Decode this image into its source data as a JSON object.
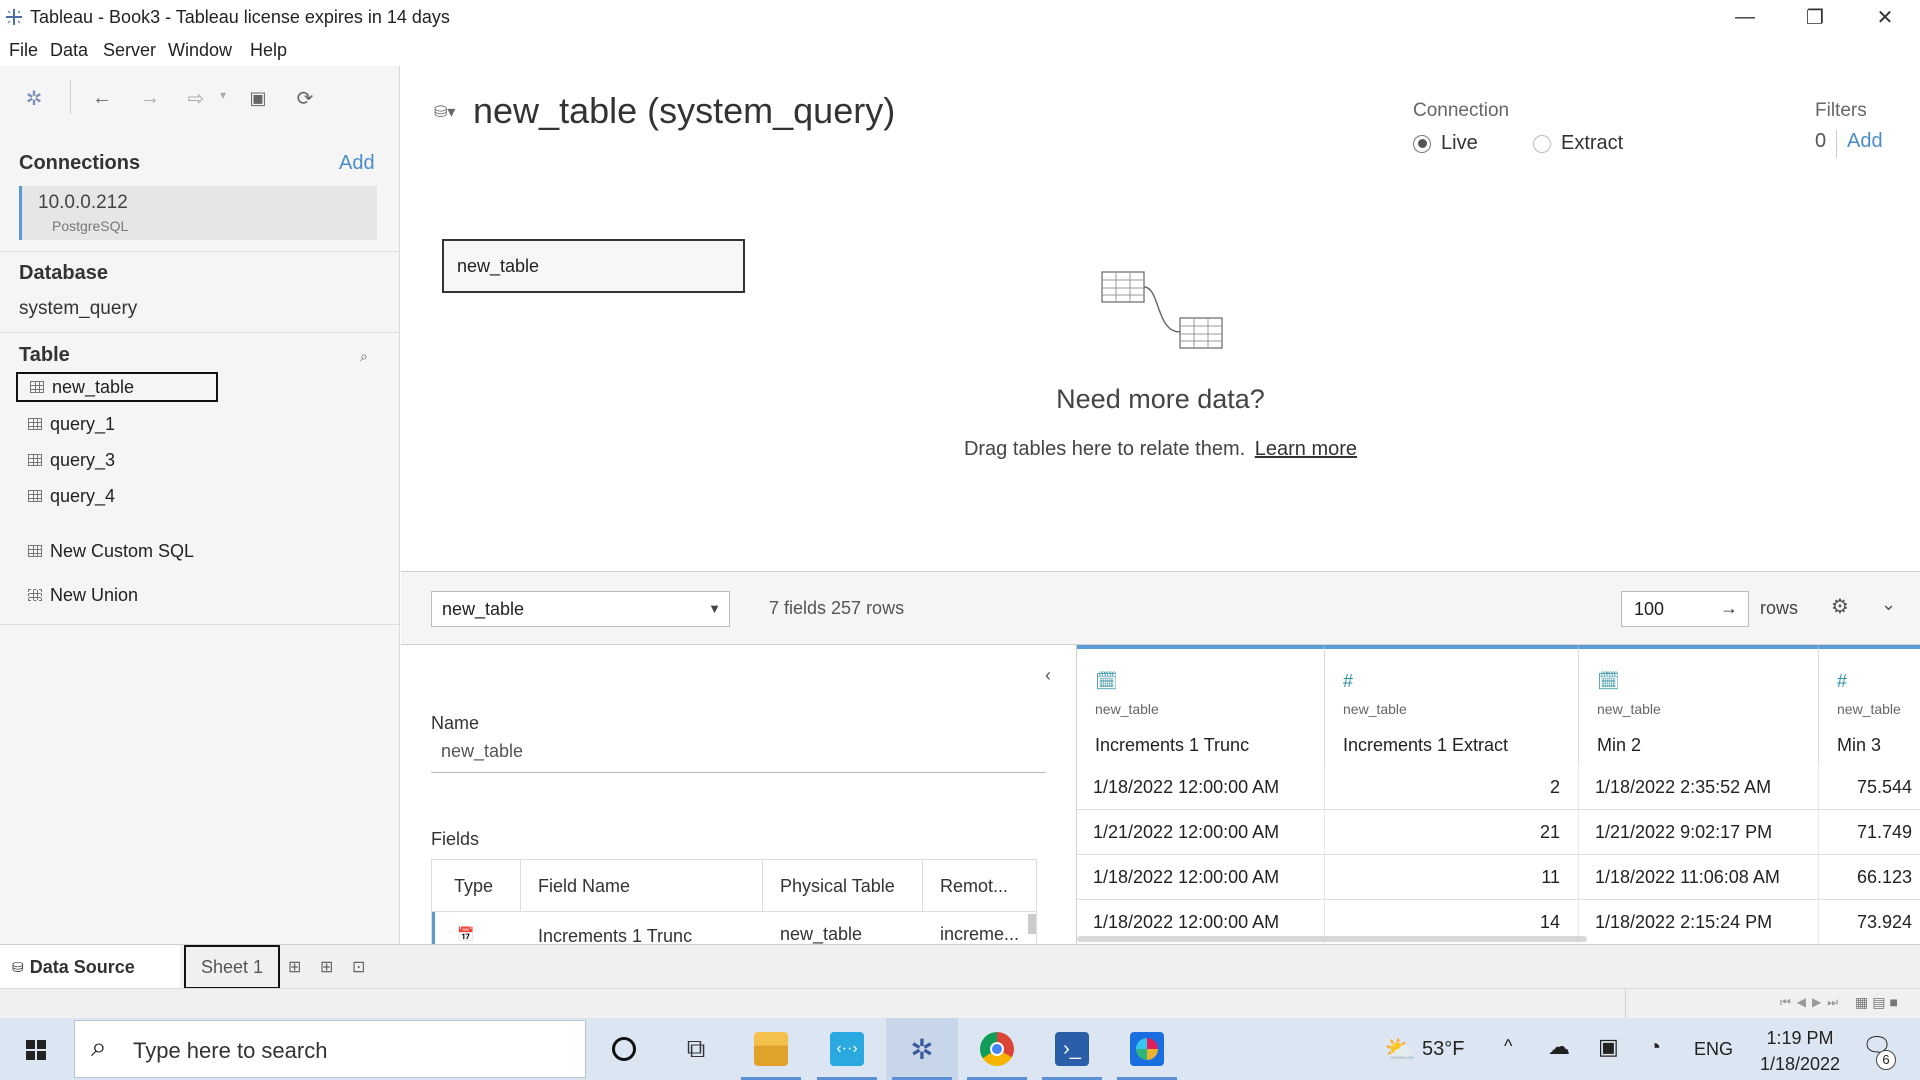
{
  "window": {
    "title": "Tableau - Book3 - Tableau license expires in 14 days",
    "minimize": "—",
    "restore": "❐",
    "close": "✕"
  },
  "menu": [
    "File",
    "Data",
    "Server",
    "Window",
    "Help"
  ],
  "left": {
    "connections_title": "Connections",
    "add_label": "Add",
    "connection": {
      "host": "10.0.0.212",
      "type": "PostgreSQL"
    },
    "database_title": "Database",
    "database_name": "system_query",
    "table_title": "Table",
    "tables": [
      "new_table",
      "query_1",
      "query_3",
      "query_4"
    ],
    "custom_sql": "New Custom SQL",
    "new_union": "New Union"
  },
  "canvas": {
    "title": "new_table (system_query)",
    "connection_label": "Connection",
    "live_label": "Live",
    "extract_label": "Extract",
    "connection_mode": "Live",
    "filters_label": "Filters",
    "filters_count": "0",
    "filters_add": "Add",
    "table_box": "new_table",
    "need_more": "Need more data?",
    "drag_hint": "Drag tables here to relate them.",
    "learn_more": "Learn more"
  },
  "bar": {
    "table_select": "new_table",
    "summary": "7 fields 257 rows",
    "rows_value": "100",
    "rows_label": "rows"
  },
  "meta": {
    "name_label": "Name",
    "name_value": "new_table",
    "fields_label": "Fields",
    "columns": [
      "Type",
      "Field Name",
      "Physical Table",
      "Remot..."
    ],
    "first_row": {
      "field": "Increments 1 Trunc",
      "table": "new_table",
      "remote": "increme..."
    }
  },
  "grid": {
    "columns": [
      {
        "icon": "date-time-icon",
        "source": "new_table",
        "name": "Increments 1 Trunc"
      },
      {
        "icon": "number-icon",
        "source": "new_table",
        "name": "Increments 1 Extract"
      },
      {
        "icon": "date-time-icon",
        "source": "new_table",
        "name": "Min 2"
      },
      {
        "icon": "number-icon",
        "source": "new_table",
        "name": "Min 3"
      }
    ],
    "rows": [
      [
        "1/18/2022 12:00:00 AM",
        "2",
        "1/18/2022 2:35:52 AM",
        "75.544"
      ],
      [
        "1/21/2022 12:00:00 AM",
        "21",
        "1/21/2022 9:02:17 PM",
        "71.749"
      ],
      [
        "1/18/2022 12:00:00 AM",
        "11",
        "1/18/2022 11:06:08 AM",
        "66.123"
      ],
      [
        "1/18/2022 12:00:00 AM",
        "14",
        "1/18/2022 2:15:24 PM",
        "73.924"
      ]
    ]
  },
  "tabs": {
    "data_source": "Data Source",
    "sheet1": "Sheet 1"
  },
  "taskbar": {
    "search_placeholder": "Type here to search",
    "weather": "53°F",
    "lang": "ENG",
    "time": "1:19 PM",
    "date": "1/18/2022",
    "notifications": "6"
  }
}
